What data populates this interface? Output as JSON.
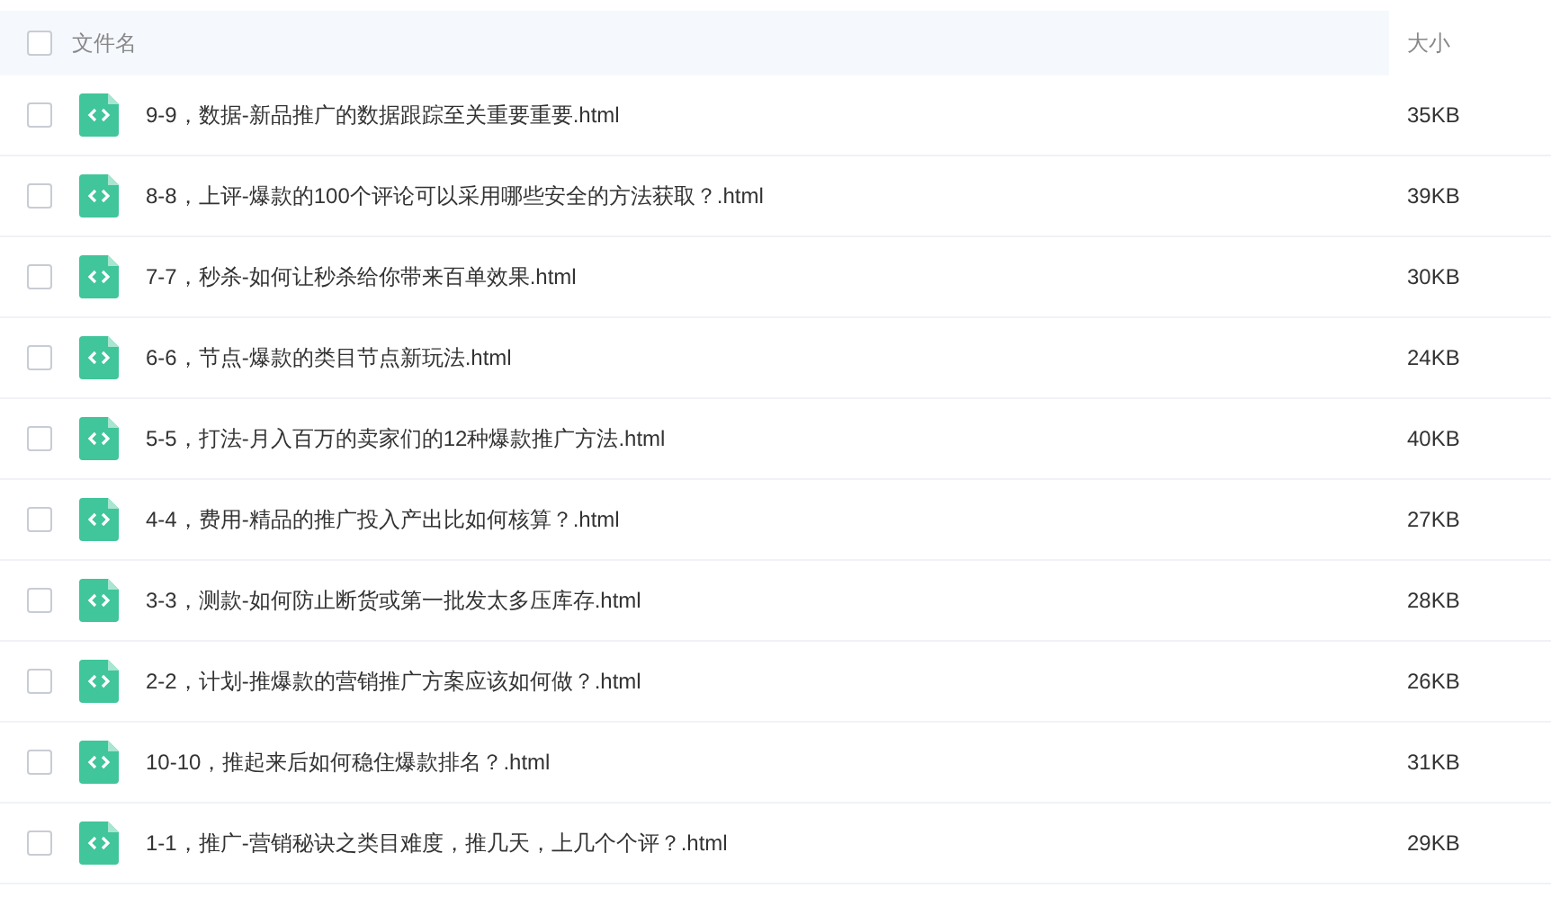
{
  "table": {
    "header": {
      "checked": false,
      "columns": [
        "文件名",
        "大小"
      ]
    },
    "rows": [
      {
        "checked": false,
        "name": "9-9，数据-新品推广的数据跟踪至关重要重要.html",
        "size": "35KB"
      },
      {
        "checked": false,
        "name": "8-8，上评-爆款的100个评论可以采用哪些安全的方法获取？.html",
        "size": "39KB"
      },
      {
        "checked": false,
        "name": "7-7，秒杀-如何让秒杀给你带来百单效果.html",
        "size": "30KB"
      },
      {
        "checked": false,
        "name": "6-6，节点-爆款的类目节点新玩法.html",
        "size": "24KB"
      },
      {
        "checked": false,
        "name": "5-5，打法-月入百万的卖家们的12种爆款推广方法.html",
        "size": "40KB"
      },
      {
        "checked": false,
        "name": "4-4，费用-精品的推广投入产出比如何核算？.html",
        "size": "27KB"
      },
      {
        "checked": false,
        "name": "3-3，测款-如何防止断货或第一批发太多压库存.html",
        "size": "28KB"
      },
      {
        "checked": false,
        "name": "2-2，计划-推爆款的营销推广方案应该如何做？.html",
        "size": "26KB"
      },
      {
        "checked": false,
        "name": "10-10，推起来后如何稳住爆款排名？.html",
        "size": "31KB"
      },
      {
        "checked": false,
        "name": "1-1，推广-营销秘诀之类目难度，推几天，上几个个评？.html",
        "size": "29KB"
      }
    ]
  }
}
